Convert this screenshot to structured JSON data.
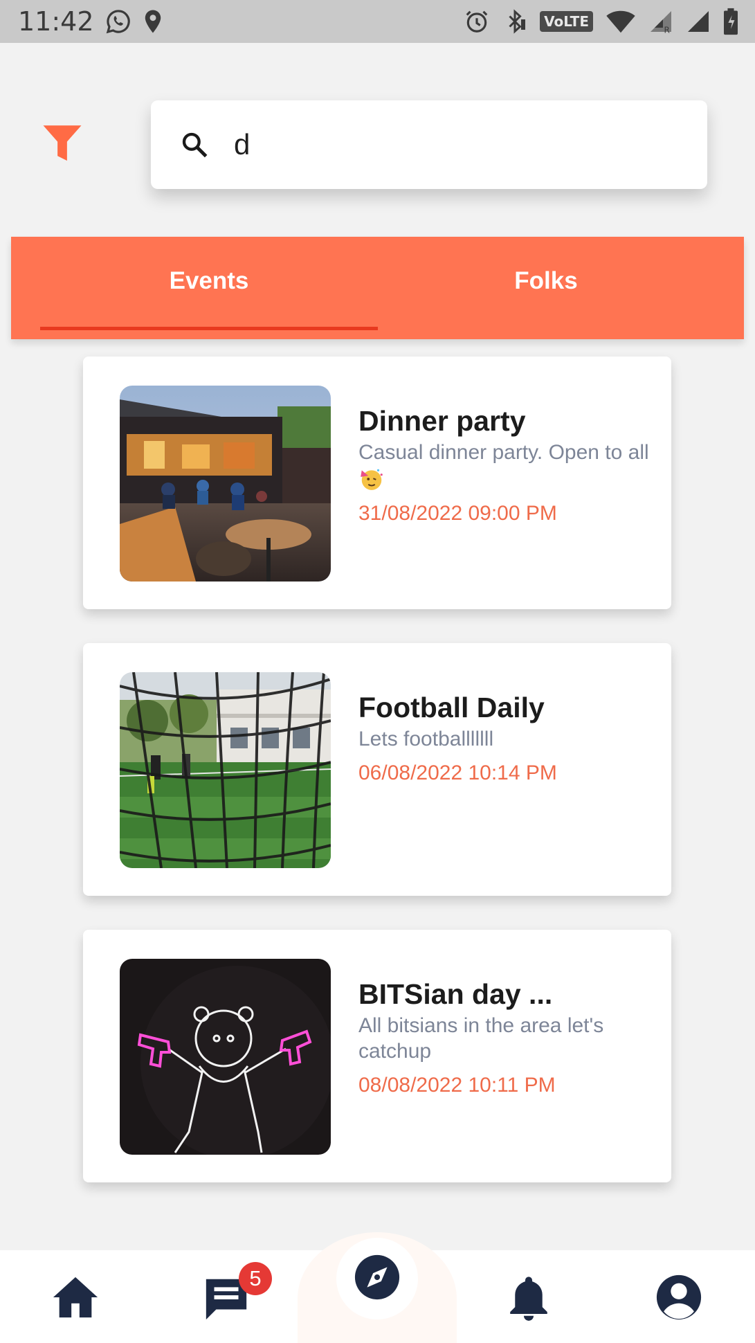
{
  "status_bar": {
    "time": "11:42",
    "network_badge": "VoLTE",
    "icons": [
      "whatsapp-icon",
      "location-icon",
      "alarm-icon",
      "bluetooth-icon",
      "wifi-icon",
      "signal-icon",
      "battery-icon"
    ]
  },
  "search": {
    "value": "d",
    "placeholder": ""
  },
  "tabs": [
    {
      "label": "Events",
      "selected": true
    },
    {
      "label": "Folks",
      "selected": false
    }
  ],
  "events": [
    {
      "title": "Dinner party",
      "description": "Casual dinner party. Open to all",
      "emoji": "party-face-emoji",
      "datetime": "31/08/2022 09:00 PM",
      "image": "restaurant-photo"
    },
    {
      "title": "Football Daily",
      "description": "Lets footballlllll",
      "datetime": "06/08/2022 10:14 PM",
      "image": "football-field-photo"
    },
    {
      "title": "BITSian day ...",
      "description": "All bitsians in the area let's catchup",
      "datetime": "08/08/2022 10:11 PM",
      "image": "neon-panda-photo"
    }
  ],
  "bottom_nav": {
    "items": [
      "home-icon",
      "chat-icon",
      "explore-icon",
      "bell-icon",
      "profile-icon"
    ],
    "chat_badge": "5"
  },
  "colors": {
    "accent": "#ff7452",
    "indicator": "#e8391f",
    "date_text": "#ef6b4a",
    "desc_text": "#7d8597",
    "nav_icon": "#1e2a44",
    "badge": "#e53935"
  }
}
